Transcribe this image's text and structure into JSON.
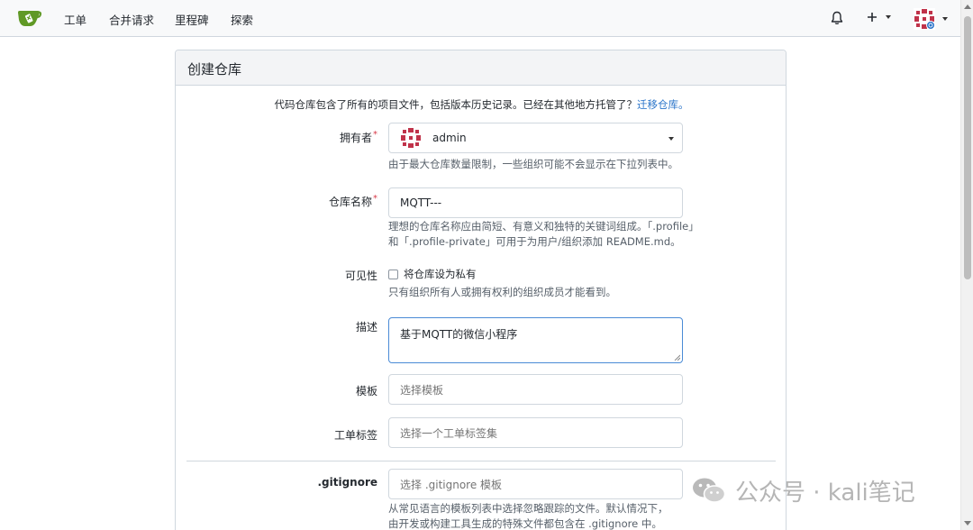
{
  "nav": {
    "items": [
      "工单",
      "合并请求",
      "里程碑",
      "探索"
    ]
  },
  "card": {
    "title": "创建仓库",
    "intro_text": "代码仓库包含了所有的项目文件，包括版本历史记录。已经在其他地方托管了？",
    "migrate_link": "迁移仓库。"
  },
  "form": {
    "owner": {
      "label": "拥有者",
      "value": "admin",
      "help": "由于最大仓库数量限制，一些组织可能不会显示在下拉列表中。"
    },
    "repo_name": {
      "label": "仓库名称",
      "value": "MQTT---",
      "help_line1": "理想的仓库名称应由简短、有意义和独特的关键词组成。「.profile」",
      "help_line2": "和「.profile-private」可用于为用户/组织添加 README.md。"
    },
    "visibility": {
      "label": "可见性",
      "checkbox_label": "将仓库设为私有",
      "checked": false,
      "help": "只有组织所有人或拥有权利的组织成员才能看到。"
    },
    "description": {
      "label": "描述",
      "value": "基于MQTT的微信小程序"
    },
    "template": {
      "label": "模板",
      "placeholder": "选择模板"
    },
    "issue_labels": {
      "label": "工单标签",
      "placeholder": "选择一个工单标签集"
    },
    "gitignore": {
      "label": ".gitignore",
      "placeholder": "选择 .gitignore 模板",
      "help_line1": "从常见语言的模板列表中选择忽略跟踪的文件。默认情况下，",
      "help_line2": "由开发或构建工具生成的特殊文件都包含在 .gitignore 中。"
    }
  },
  "watermark": {
    "text": "公众号 · kali笔记"
  },
  "colors": {
    "accent": "#4a8bd6",
    "link": "#2a74c9",
    "logo_green": "#609926",
    "required": "#d73a49"
  },
  "icons": {
    "notification": "bell-icon",
    "create": "plus-icon",
    "user": "avatar-icon"
  }
}
